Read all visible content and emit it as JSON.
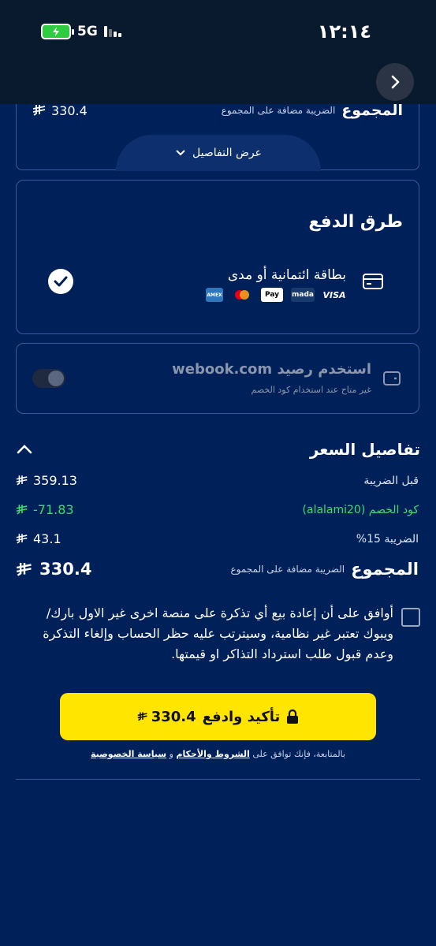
{
  "status_bar": {
    "time": "١٢:١٤",
    "network": "5G"
  },
  "summary": {
    "total_label": "المجموع",
    "tax_note": "الضريبة مضافة على المجموع",
    "amount": "330.4",
    "show_details_label": "عرض التفاصيل"
  },
  "payment": {
    "title": "طرق الدفع",
    "option_label": "بطاقة ائتمانية أو مدى",
    "brands": [
      "VISA",
      "mada",
      "Pay",
      "mastercard",
      "AMEX"
    ]
  },
  "wallet": {
    "title": "استخدم رصيد webook.com",
    "subtitle": "غير متاح عند استخدام كود الخصم"
  },
  "price_details": {
    "title": "تفاصيل السعر",
    "rows": [
      {
        "label": "قبل الضريبة",
        "value": "359.13"
      },
      {
        "label": "كود الخصم (alalami20)",
        "value": "-71.83"
      },
      {
        "label": "الضريبة 15%",
        "value": "43.1"
      }
    ],
    "total_label": "المجموع",
    "tax_note": "الضريبة مضافة على المجموع",
    "total_value": "330.4"
  },
  "terms": {
    "text": "أوافق على أن إعادة بيع أي تذكرة على منصة اخرى غير الاول بارك/ ويبوك تعتبر غير نظامية، وسيترتب عليه حظر الحساب وإلغاء التذكرة وعدم قبول طلب استرداد التذاكر او قيمتها."
  },
  "confirm": {
    "label": "تأكيد وادفع",
    "amount": "330.4"
  },
  "footnote": {
    "prefix": "بالمتابعة، فإنك توافق على",
    "terms_link": "الشروط والأحكام",
    "and": "و",
    "privacy_link": "سياسة الخصوصية"
  },
  "colors": {
    "background": "#00205a",
    "accent_yellow": "#ffe500",
    "discount_green": "#3ddc6b",
    "card_border": "#3b5a9c"
  }
}
